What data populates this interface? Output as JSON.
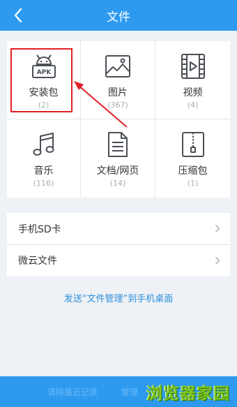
{
  "topbar": {
    "title": "文件",
    "back_icon": "chevron-left-icon"
  },
  "categories": [
    {
      "label": "安装包",
      "count": "(2)",
      "icon": "apk-android-icon"
    },
    {
      "label": "图片",
      "count": "(367)",
      "icon": "image-icon"
    },
    {
      "label": "视频",
      "count": "(4)",
      "icon": "video-film-icon"
    },
    {
      "label": "音乐",
      "count": "(116)",
      "icon": "music-note-icon"
    },
    {
      "label": "文档/网页",
      "count": "(14)",
      "icon": "document-icon"
    },
    {
      "label": "压缩包",
      "count": "(1)",
      "icon": "zip-archive-icon"
    }
  ],
  "apk_badge": "APK",
  "storage": [
    {
      "label": "手机SD卡"
    },
    {
      "label": "微云文件"
    }
  ],
  "send_link": "发送“文件管理”到手机桌面",
  "bottombar": {
    "hint_left": "清除最近记录",
    "hint_right": "管理"
  },
  "watermark": "浏览器家园",
  "colors": {
    "primary": "#2d9af0",
    "annotation": "#e21f26",
    "link": "#2d8fdc"
  }
}
